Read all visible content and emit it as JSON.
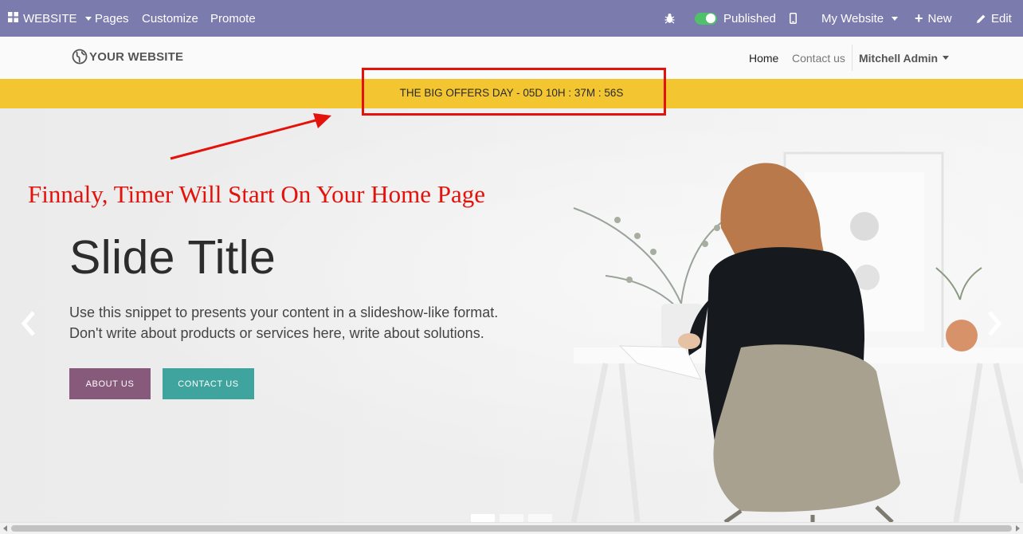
{
  "admin_bar": {
    "website_menu": "WEBSITE",
    "pages": "Pages",
    "customize": "Customize",
    "promote": "Promote",
    "published": "Published",
    "my_website": "My Website",
    "new": "New",
    "edit": "Edit",
    "bg_color": "#7c7bad"
  },
  "site_header": {
    "logo_text": "YOUR WEBSITE",
    "nav_home": "Home",
    "nav_contact": "Contact us",
    "user": "Mitchell Admin"
  },
  "offer_bar": {
    "text": "THE BIG OFFERS DAY - 05D 10H : 37M : 56S",
    "color": "#f2c531"
  },
  "annotation": {
    "text": "Finnaly, Timer Will Start On Your Home Page",
    "color": "#e3120b"
  },
  "hero": {
    "title": "Slide Title",
    "line1": "Use this snippet to presents your content in a slideshow-like format.",
    "line2": "Don't write about products or services here, write about solutions.",
    "about_button": "ABOUT US",
    "contact_button": "CONTACT US",
    "about_color": "#875a7b",
    "contact_color": "#3fa39e"
  }
}
